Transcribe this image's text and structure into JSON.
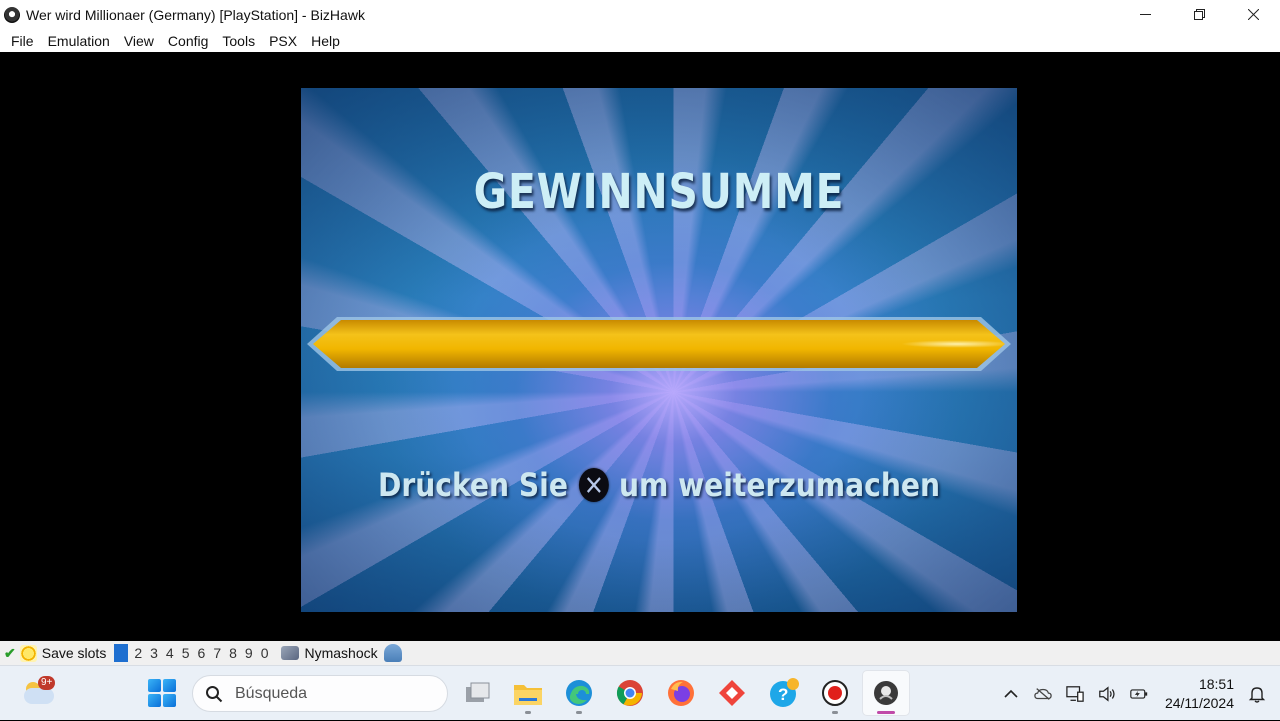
{
  "window": {
    "title": "Wer wird Millionaer (Germany) [PlayStation] - BizHawk"
  },
  "menu": [
    "File",
    "Emulation",
    "View",
    "Config",
    "Tools",
    "PSX",
    "Help"
  ],
  "game": {
    "title": "GEWINNSUMME",
    "prompt_before": "Drücken Sie",
    "prompt_after": "um weiterzumachen",
    "button_icon": "playstation-cross-button"
  },
  "statusbar": {
    "save_slots_label": "Save slots",
    "slots": [
      "1",
      "2",
      "3",
      "4",
      "5",
      "6",
      "7",
      "8",
      "9",
      "0"
    ],
    "active_slot": "1",
    "core_name": "Nymashock"
  },
  "taskbar": {
    "weather_badge": "9+",
    "search_placeholder": "Búsqueda",
    "apps": [
      "task-view",
      "file-explorer",
      "edge",
      "chrome",
      "firefox",
      "anydesk",
      "help",
      "recorder",
      "bizhawk"
    ],
    "time": "18:51",
    "date": "24/11/2024"
  },
  "colors": {
    "gold": "#f2b800",
    "game_blue": "#2d86c4",
    "accent": "#1e6fd0"
  }
}
